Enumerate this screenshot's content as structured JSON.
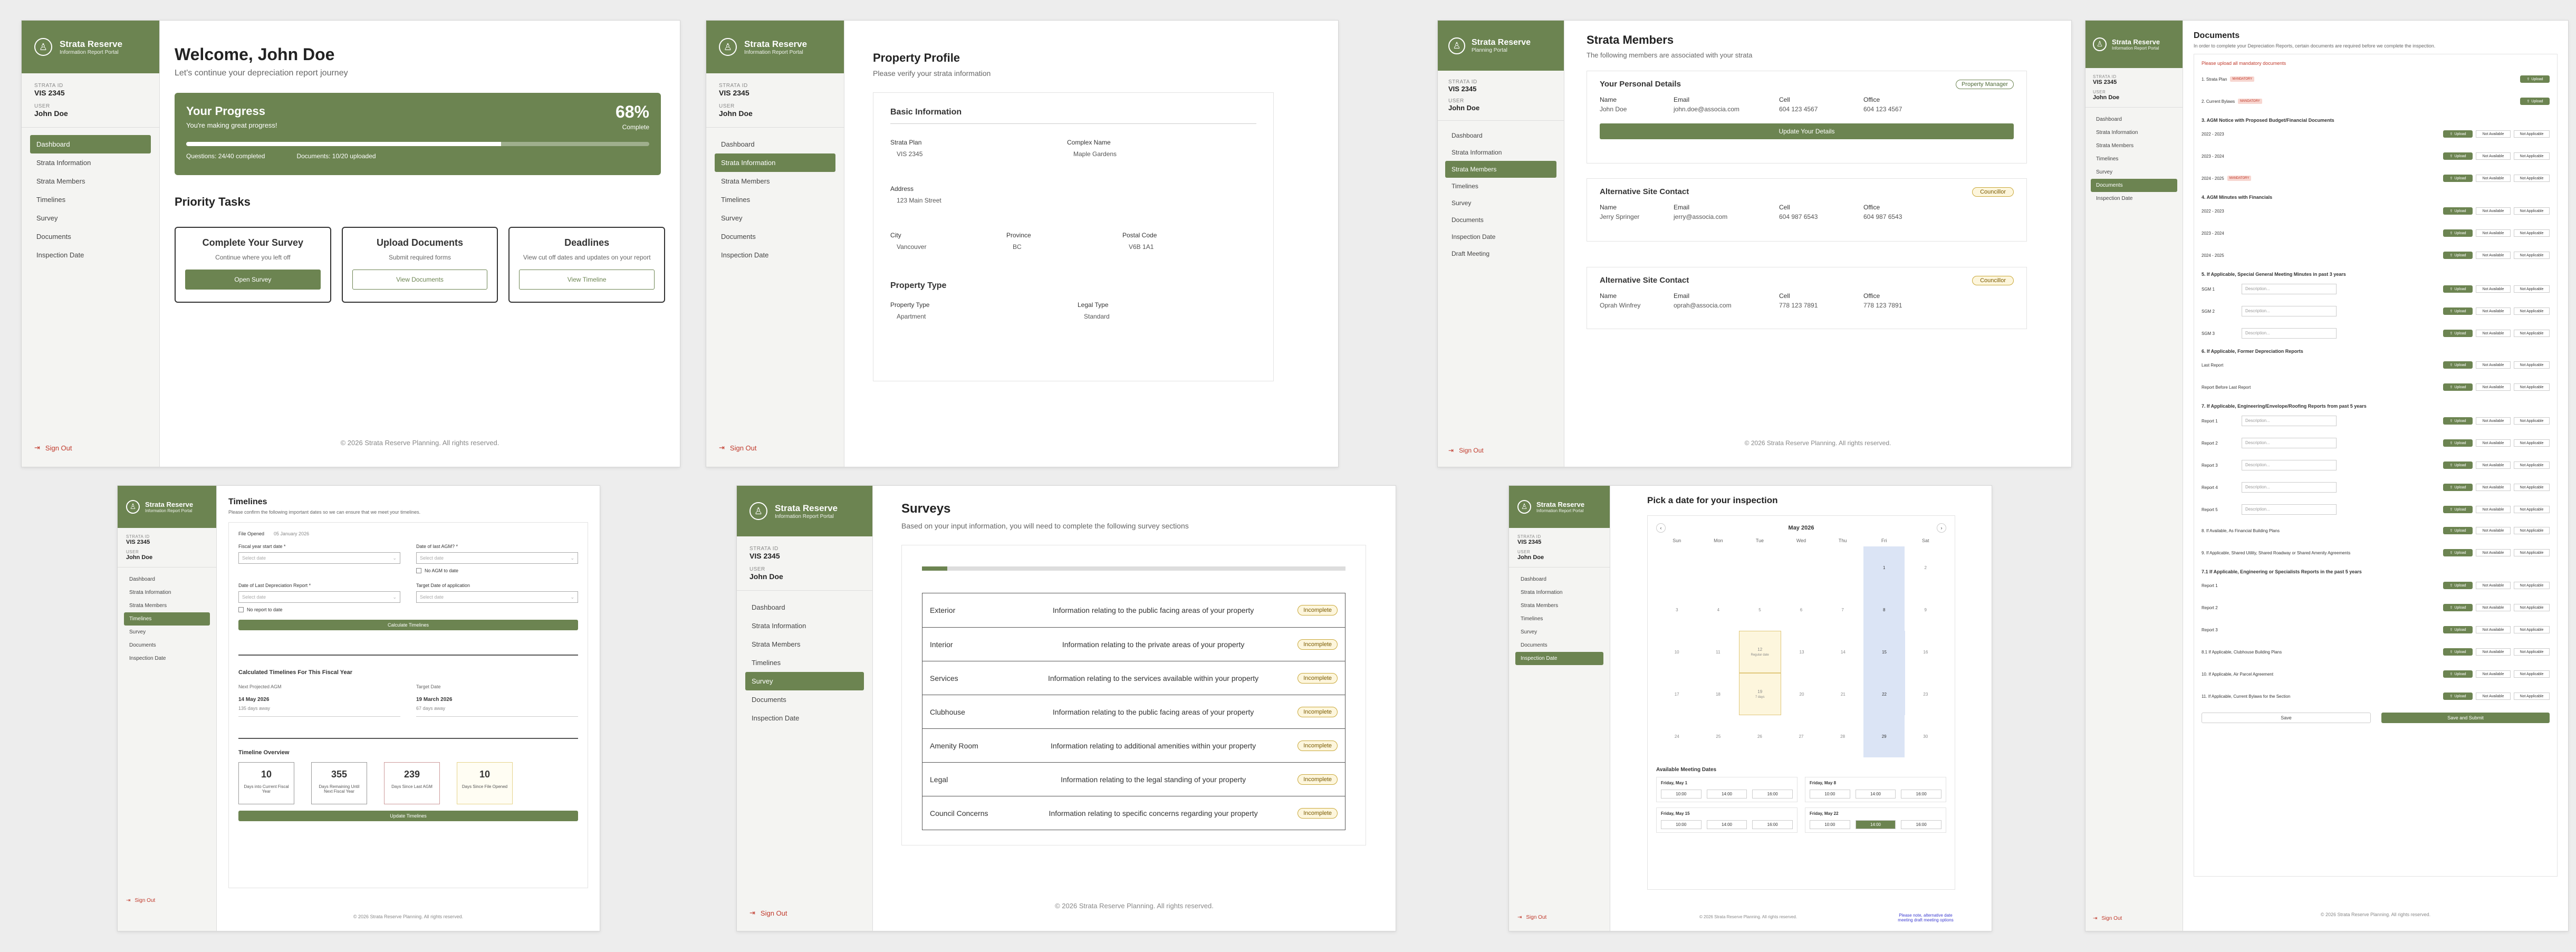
{
  "brand": {
    "name": "Strata Reserve",
    "tag_info": "Information Report Portal",
    "tag_plan": "Planning Portal"
  },
  "meta": {
    "strata_label": "STRATA ID",
    "strata": "VIS 2345",
    "user_label": "USER",
    "user": "John Doe"
  },
  "nav": [
    "Dashboard",
    "Strata Information",
    "Strata Members",
    "Timelines",
    "Survey",
    "Documents",
    "Inspection Date"
  ],
  "nav_dm": [
    "Dashboard",
    "Strata Information",
    "Strata Members",
    "Timelines",
    "Survey",
    "Documents",
    "Inspection Date",
    "Draft Meeting"
  ],
  "signout": "Sign Out",
  "footer": "© 2026 Strata Reserve Planning. All rights reserved.",
  "colors": {
    "brand": "#6c8451",
    "badge": "#c9a83a",
    "danger": "#c0392b"
  },
  "dashboard": {
    "title": "Welcome, John Doe",
    "subtitle": "Let's continue your depreciation report journey",
    "progress_title": "Your Progress",
    "progress_sub": "You're making great progress!",
    "percent": "68%",
    "complete": "Complete",
    "fill": 0.68,
    "questions": "Questions: 24/40 completed",
    "documents": "Documents: 10/20 uploaded",
    "priority": "Priority Tasks",
    "tasks": [
      {
        "title": "Complete Your Survey",
        "desc": "Continue where you left off",
        "btn": "Open Survey"
      },
      {
        "title": "Upload Documents",
        "desc": "Submit required forms",
        "btn": "View Documents"
      },
      {
        "title": "Deadlines",
        "desc": "View cut off dates and updates on your report",
        "btn": "View Timeline"
      }
    ]
  },
  "profile": {
    "title": "Property Profile",
    "subtitle": "Please verify your strata information",
    "basic": "Basic Information",
    "strata_plan_l": "Strata Plan",
    "strata_plan": "VIS 2345",
    "complex_l": "Complex Name",
    "complex": "Maple Gardens",
    "address_l": "Address",
    "address": "123 Main Street",
    "city_l": "City",
    "city": "Vancouver",
    "prov_l": "Province",
    "prov": "BC",
    "postal_l": "Postal Code",
    "postal": "V6B 1A1",
    "ptype": "Property Type",
    "ptype_l": "Property Type",
    "ptype_v": "Apartment",
    "legal_l": "Legal Type",
    "legal_v": "Standard"
  },
  "members": {
    "title": "Strata Members",
    "subtitle": "The following members are associated with your strata",
    "cols": [
      "Name",
      "Email",
      "Cell",
      "Office"
    ],
    "cards": [
      {
        "title": "Your Personal Details",
        "badge": "Property Manager",
        "name": "John Doe",
        "email": "john.doe@associa.com",
        "cell": "604 123 4567",
        "office": "604 123 4567",
        "btn": "Update Your Details"
      },
      {
        "title": "Alternative Site Contact",
        "badge": "Councillor",
        "name": "Jerry Springer",
        "email": "jerry@associa.com",
        "cell": "604 987 6543",
        "office": "604 987 6543"
      },
      {
        "title": "Alternative Site Contact",
        "badge": "Councillor",
        "name": "Oprah Winfrey",
        "email": "oprah@associa.com",
        "cell": "778 123 7891",
        "office": "778 123 7891"
      }
    ]
  },
  "docs": {
    "title": "Documents",
    "subtitle": "In order to complete your Depreciation Reports, certain documents are required before we complete the inspection.",
    "warn": "Please upload all mandatory documents",
    "upload": "Upload",
    "na": "Not Available",
    "napp": "Not Applicable",
    "mandatory": "MANDATORY",
    "desc_ph": "Description...",
    "rows": [
      {
        "t": "row",
        "label": "1. Strata Plan",
        "tag": "MANDATORY",
        "mini": true
      },
      {
        "t": "row",
        "label": "2. Current Bylaws",
        "tag": "MANDATORY",
        "mini": true
      },
      {
        "t": "head",
        "label": "3. AGM Notice with Proposed Budget/Financial Documents"
      },
      {
        "t": "row",
        "label": "2022 - 2023"
      },
      {
        "t": "row",
        "label": "2023 - 2024"
      },
      {
        "t": "row",
        "label": "2024 - 2025",
        "tag": "MANDATORY"
      },
      {
        "t": "head",
        "label": "4. AGM Minutes with Financials"
      },
      {
        "t": "row",
        "label": "2022 - 2023"
      },
      {
        "t": "row",
        "label": "2023 - 2024"
      },
      {
        "t": "row",
        "label": "2024 - 2025"
      },
      {
        "t": "head",
        "label": "5. If Applicable, Special General Meeting Minutes in past 3 years"
      },
      {
        "t": "row",
        "label": "SGM 1",
        "input": true
      },
      {
        "t": "row",
        "label": "SGM 2",
        "input": true
      },
      {
        "t": "row",
        "label": "SGM 3",
        "input": true
      },
      {
        "t": "head",
        "label": "6. If Applicable, Former Depreciation Reports"
      },
      {
        "t": "row",
        "label": "Last Report"
      },
      {
        "t": "row",
        "label": "Report Before Last Report"
      },
      {
        "t": "head",
        "label": "7. If Applicable, Engineering/Envelope/Roofing Reports from past 5 years"
      },
      {
        "t": "row",
        "label": "Report 1",
        "input": true
      },
      {
        "t": "row",
        "label": "Report 2",
        "input": true
      },
      {
        "t": "row",
        "label": "Report 3",
        "input": true
      },
      {
        "t": "row",
        "label": "Report 4",
        "input": true
      },
      {
        "t": "row",
        "label": "Report 5",
        "input": true
      },
      {
        "t": "row",
        "label": "8. If Available, As Financial Building Plans"
      },
      {
        "t": "row",
        "label": "9. If Applicable, Shared Utility, Shared Roadway or Shared Amenity Agreements"
      },
      {
        "t": "head",
        "label": "7.1 If Applicable, Engineering or Specialists Reports in the past 5 years"
      },
      {
        "t": "row",
        "label": "Report 1"
      },
      {
        "t": "row",
        "label": "Report 2"
      },
      {
        "t": "row",
        "label": "Report 3"
      },
      {
        "t": "row",
        "label": "8.1 If Applicable, Clubhouse Building Plans"
      },
      {
        "t": "row",
        "label": "10. If Applicable, Air Parcel Agreement"
      },
      {
        "t": "row",
        "label": "11. If Applicable, Current Bylaws for the Section"
      }
    ],
    "save": "Save",
    "save_submit": "Save and Submit"
  },
  "timelines": {
    "title": "Timelines",
    "subtitle": "Please confirm the following important dates so we can ensure that we meet your timelines.",
    "file_opened": "File Opened",
    "file_opened_v": "05 January 2026",
    "fy_l": "Fiscal year start date *",
    "fy_ph": "Select date",
    "agm_l": "Date of last AGM? *",
    "agm_ph": "Select date",
    "no_agm": "No AGM to date",
    "ldr_l": "Date of Last Depreciation Report *",
    "ldr_ph": "Select date",
    "app_l": "Target Date of application",
    "app_ph": "Select date",
    "no_report": "No report to date",
    "calc_btn": "Calculate Timelines",
    "calc_title": "Calculated Timelines For This Fiscal Year",
    "next_agm_l": "Next Projected AGM",
    "next_agm": "14 May 2026",
    "next_agm_s": "135 days away",
    "target_l": "Target Date",
    "target": "19 March 2026",
    "target_s": "67 days away",
    "overview": "Timeline Overview",
    "ov": [
      {
        "n": "10",
        "t": "Days into Current Fiscal Year"
      },
      {
        "n": "355",
        "t": "Days Remaining Until Next Fiscal Year"
      },
      {
        "n": "239",
        "t": "Days Since Last AGM"
      },
      {
        "n": "10",
        "t": "Days Since File Opened"
      }
    ],
    "update": "Update Timelines"
  },
  "surveys": {
    "title": "Surveys",
    "subtitle": "Based on your input information, you will need to complete the following survey sections",
    "progress": 0.06,
    "status": "Incomplete",
    "rows": [
      {
        "name": "Exterior",
        "desc": "Information relating to the public facing areas of your property"
      },
      {
        "name": "Interior",
        "desc": "Information relating to the private areas of your property"
      },
      {
        "name": "Services",
        "desc": "Information relating to the services available within your property"
      },
      {
        "name": "Clubhouse",
        "desc": "Information relating to the public facing areas of your property"
      },
      {
        "name": "Amenity Room",
        "desc": "Information relating to additional amenities within your property"
      },
      {
        "name": "Legal",
        "desc": "Information relating to the legal standing of your property"
      },
      {
        "name": "Council Concerns",
        "desc": "Information relating to specific concerns regarding your property"
      }
    ]
  },
  "inspection": {
    "title": "Pick a date for your inspection",
    "month": "May 2026",
    "days": [
      "Sun",
      "Mon",
      "Tue",
      "Wed",
      "Thu",
      "Fri",
      "Sat"
    ],
    "available_title": "Available Meeting Dates",
    "slots": [
      {
        "day": "Friday, May 1",
        "times": [
          "10:00",
          "14:00",
          "16:00"
        ]
      },
      {
        "day": "Friday, May 8",
        "times": [
          "10:00",
          "14:00",
          "16:00"
        ]
      },
      {
        "day": "Friday, May 15",
        "times": [
          "10:00",
          "14:00",
          "16:00"
        ]
      },
      {
        "day": "Friday, May 22",
        "times": [
          "10:00",
          "14:00",
          "16:00"
        ]
      }
    ],
    "note": "Please note, alternative date meeting draft meeting options",
    "ev1": "Regular date",
    "ev2": "7 days"
  }
}
